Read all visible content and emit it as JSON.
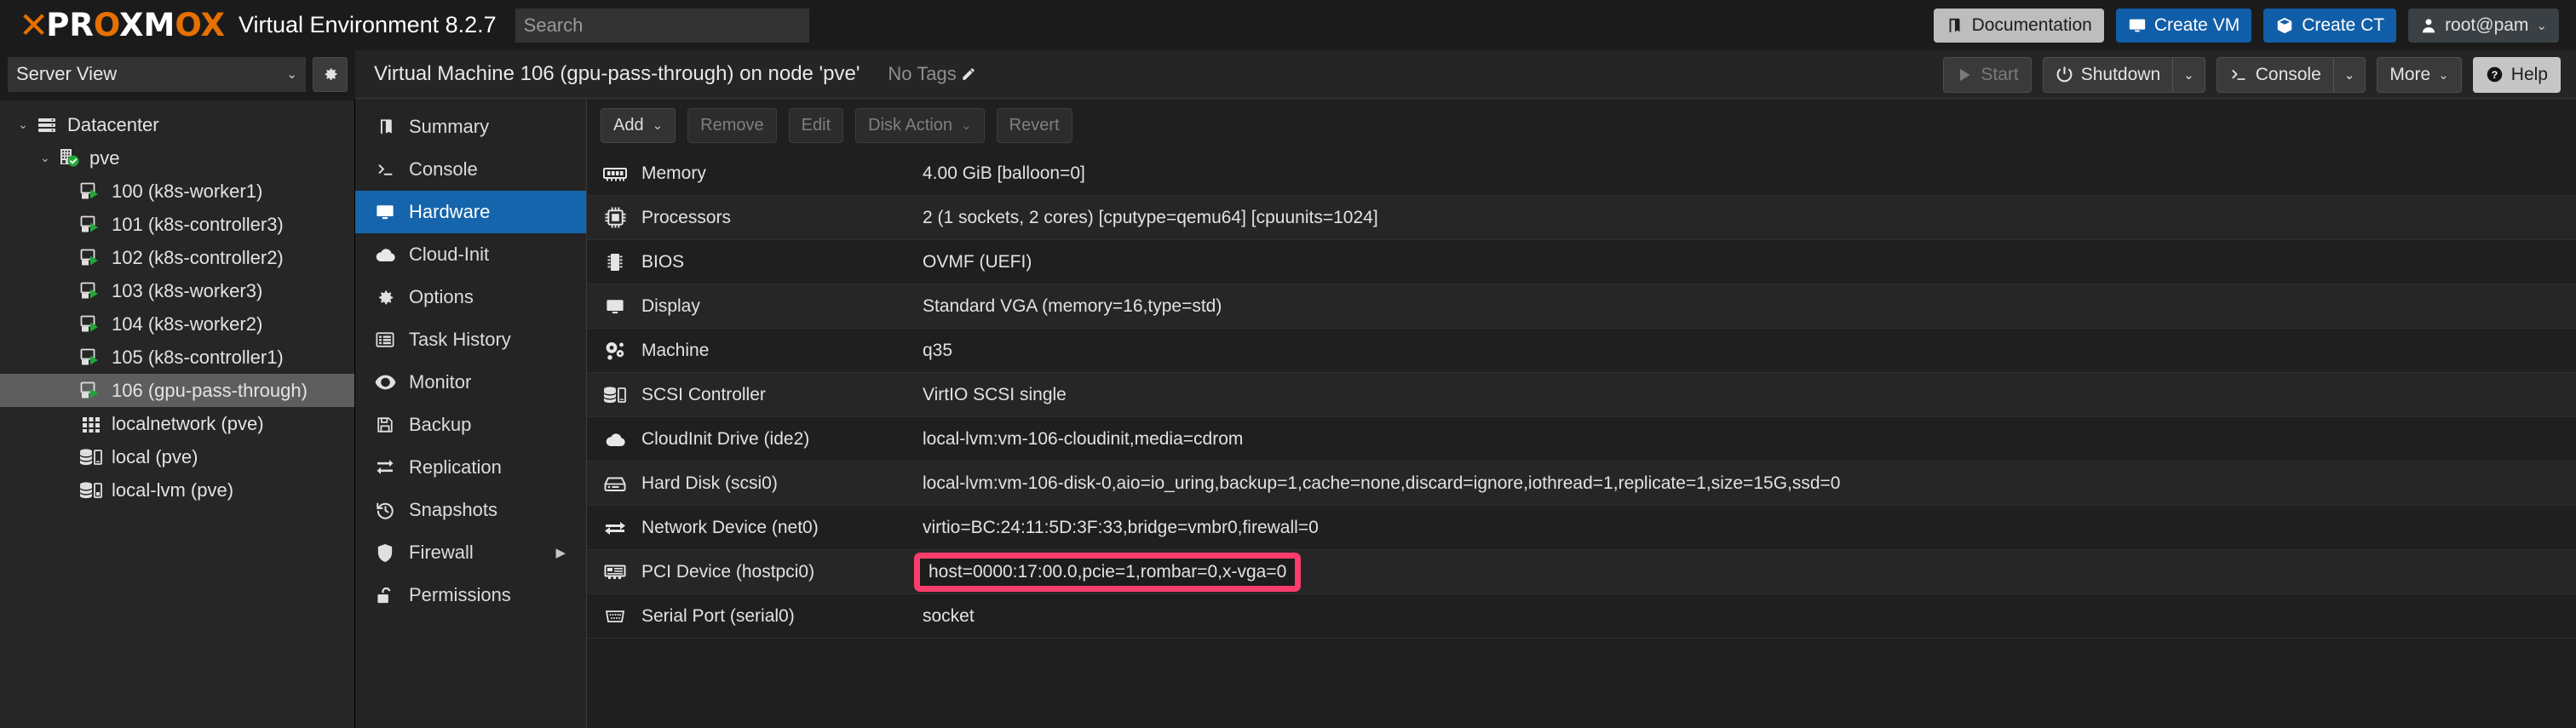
{
  "header": {
    "brand_x": "X",
    "brand_word_pre": "PR",
    "brand_word_o": "O",
    "brand_word_mid": "XM",
    "brand_word_o2": "O",
    "brand_word_post": "X",
    "brand_full": "PROXMOX",
    "product_title": "Virtual Environment 8.2.7",
    "search_placeholder": "Search",
    "search_value": "",
    "buttons": [
      {
        "label": "Documentation",
        "icon": "book-icon",
        "style": "grey"
      },
      {
        "label": "Create VM",
        "icon": "monitor-icon",
        "style": "blue"
      },
      {
        "label": "Create CT",
        "icon": "cube-icon",
        "style": "blue"
      },
      {
        "label": "root@pam",
        "icon": "user-icon",
        "style": "dark",
        "caret": "⌄"
      }
    ]
  },
  "secondbar": {
    "view_select": "Server View",
    "view_caret": "⌄",
    "gear_icon": "gear-icon",
    "vm_title": "Virtual Machine 106 (gpu-pass-through) on node 'pve'",
    "tags_label": "No Tags",
    "tags_edit_icon": "pencil-icon",
    "actions": [
      {
        "label": "Start",
        "icon": "play-icon",
        "disabled": true,
        "split": false
      },
      {
        "label": "Shutdown",
        "icon": "power-icon",
        "disabled": false,
        "split": true,
        "caret": "⌄"
      },
      {
        "label": "Console",
        "icon": "terminal-icon",
        "disabled": false,
        "split": true,
        "caret": "⌄"
      },
      {
        "label": "More",
        "icon": "",
        "disabled": false,
        "split": false,
        "caret": "⌄"
      },
      {
        "label": "Help",
        "icon": "question-icon",
        "disabled": false,
        "split": false
      }
    ]
  },
  "tree": {
    "items": [
      {
        "label": "Datacenter",
        "icon": "datacenter-icon",
        "indent": 0,
        "expander": "⌄",
        "selected": false
      },
      {
        "label": "pve",
        "icon": "node-icon",
        "indent": 1,
        "expander": "⌄",
        "selected": false
      },
      {
        "label": "100 (k8s-worker1)",
        "icon": "vm-running-icon",
        "indent": 2,
        "expander": "",
        "selected": false
      },
      {
        "label": "101 (k8s-controller3)",
        "icon": "vm-running-icon",
        "indent": 2,
        "expander": "",
        "selected": false
      },
      {
        "label": "102 (k8s-controller2)",
        "icon": "vm-running-icon",
        "indent": 2,
        "expander": "",
        "selected": false
      },
      {
        "label": "103 (k8s-worker3)",
        "icon": "vm-running-icon",
        "indent": 2,
        "expander": "",
        "selected": false
      },
      {
        "label": "104 (k8s-worker2)",
        "icon": "vm-running-icon",
        "indent": 2,
        "expander": "",
        "selected": false
      },
      {
        "label": "105 (k8s-controller1)",
        "icon": "vm-running-icon",
        "indent": 2,
        "expander": "",
        "selected": false
      },
      {
        "label": "106 (gpu-pass-through)",
        "icon": "vm-running-icon",
        "indent": 2,
        "expander": "",
        "selected": true
      },
      {
        "label": "localnetwork (pve)",
        "icon": "network-icon",
        "indent": 2,
        "expander": "",
        "selected": false
      },
      {
        "label": "local (pve)",
        "icon": "storage-icon",
        "indent": 2,
        "expander": "",
        "selected": false
      },
      {
        "label": "local-lvm (pve)",
        "icon": "storage-lvm-icon",
        "indent": 2,
        "expander": "",
        "selected": false
      }
    ]
  },
  "nav": {
    "items": [
      {
        "label": "Summary",
        "icon": "book-icon",
        "active": false,
        "submenu": false
      },
      {
        "label": "Console",
        "icon": "terminal-icon",
        "active": false,
        "submenu": false
      },
      {
        "label": "Hardware",
        "icon": "monitor-icon",
        "active": true,
        "submenu": false
      },
      {
        "label": "Cloud-Init",
        "icon": "cloud-icon",
        "active": false,
        "submenu": false
      },
      {
        "label": "Options",
        "icon": "gear-icon",
        "active": false,
        "submenu": false
      },
      {
        "label": "Task History",
        "icon": "list-icon",
        "active": false,
        "submenu": false
      },
      {
        "label": "Monitor",
        "icon": "eye-icon",
        "active": false,
        "submenu": false
      },
      {
        "label": "Backup",
        "icon": "floppy-icon",
        "active": false,
        "submenu": false
      },
      {
        "label": "Replication",
        "icon": "replication-icon",
        "active": false,
        "submenu": false
      },
      {
        "label": "Snapshots",
        "icon": "history-icon",
        "active": false,
        "submenu": false
      },
      {
        "label": "Firewall",
        "icon": "shield-icon",
        "active": false,
        "submenu": true,
        "submenu_arrow": "▶"
      },
      {
        "label": "Permissions",
        "icon": "unlock-icon",
        "active": false,
        "submenu": false
      }
    ]
  },
  "hw_toolbar": {
    "buttons": [
      {
        "label": "Add",
        "caret": "⌄",
        "dim": false
      },
      {
        "label": "Remove",
        "caret": "",
        "dim": true
      },
      {
        "label": "Edit",
        "caret": "",
        "dim": true
      },
      {
        "label": "Disk Action",
        "caret": "⌄",
        "dim": true
      },
      {
        "label": "Revert",
        "caret": "",
        "dim": true
      }
    ]
  },
  "hardware": {
    "rows": [
      {
        "icon": "memory-icon",
        "label": "Memory",
        "value": "4.00 GiB [balloon=0]",
        "highlight": false
      },
      {
        "icon": "cpu-icon",
        "label": "Processors",
        "value": "2 (1 sockets, 2 cores) [cputype=qemu64] [cpuunits=1024]",
        "highlight": false
      },
      {
        "icon": "bios-icon",
        "label": "BIOS",
        "value": "OVMF (UEFI)",
        "highlight": false
      },
      {
        "icon": "monitor-icon",
        "label": "Display",
        "value": "Standard VGA (memory=16,type=std)",
        "highlight": false
      },
      {
        "icon": "machine-icon",
        "label": "Machine",
        "value": "q35",
        "highlight": false
      },
      {
        "icon": "storage-icon",
        "label": "SCSI Controller",
        "value": "VirtIO SCSI single",
        "highlight": false
      },
      {
        "icon": "cloud-icon",
        "label": "CloudInit Drive (ide2)",
        "value": "local-lvm:vm-106-cloudinit,media=cdrom",
        "highlight": false
      },
      {
        "icon": "harddisk-icon",
        "label": "Hard Disk (scsi0)",
        "value": "local-lvm:vm-106-disk-0,aio=io_uring,backup=1,cache=none,discard=ignore,iothread=1,replicate=1,size=15G,ssd=0",
        "highlight": false
      },
      {
        "icon": "network-dev-icon",
        "label": "Network Device (net0)",
        "value": "virtio=BC:24:11:5D:3F:33,bridge=vmbr0,firewall=0",
        "highlight": false
      },
      {
        "icon": "pci-icon",
        "label": "PCI Device (hostpci0)",
        "value": "host=0000:17:00.0,pcie=1,rombar=0,x-vga=0",
        "highlight": true
      },
      {
        "icon": "serial-icon",
        "label": "Serial Port (serial0)",
        "value": "socket",
        "highlight": false
      }
    ]
  },
  "colors": {
    "brand_orange": "#e57000",
    "accent_blue": "#1565ac",
    "button_blue": "#115ea8",
    "highlight_pink": "#fb3c6c",
    "running_green": "#23a637",
    "background": "#1b1b1b",
    "panel": "#242424"
  }
}
